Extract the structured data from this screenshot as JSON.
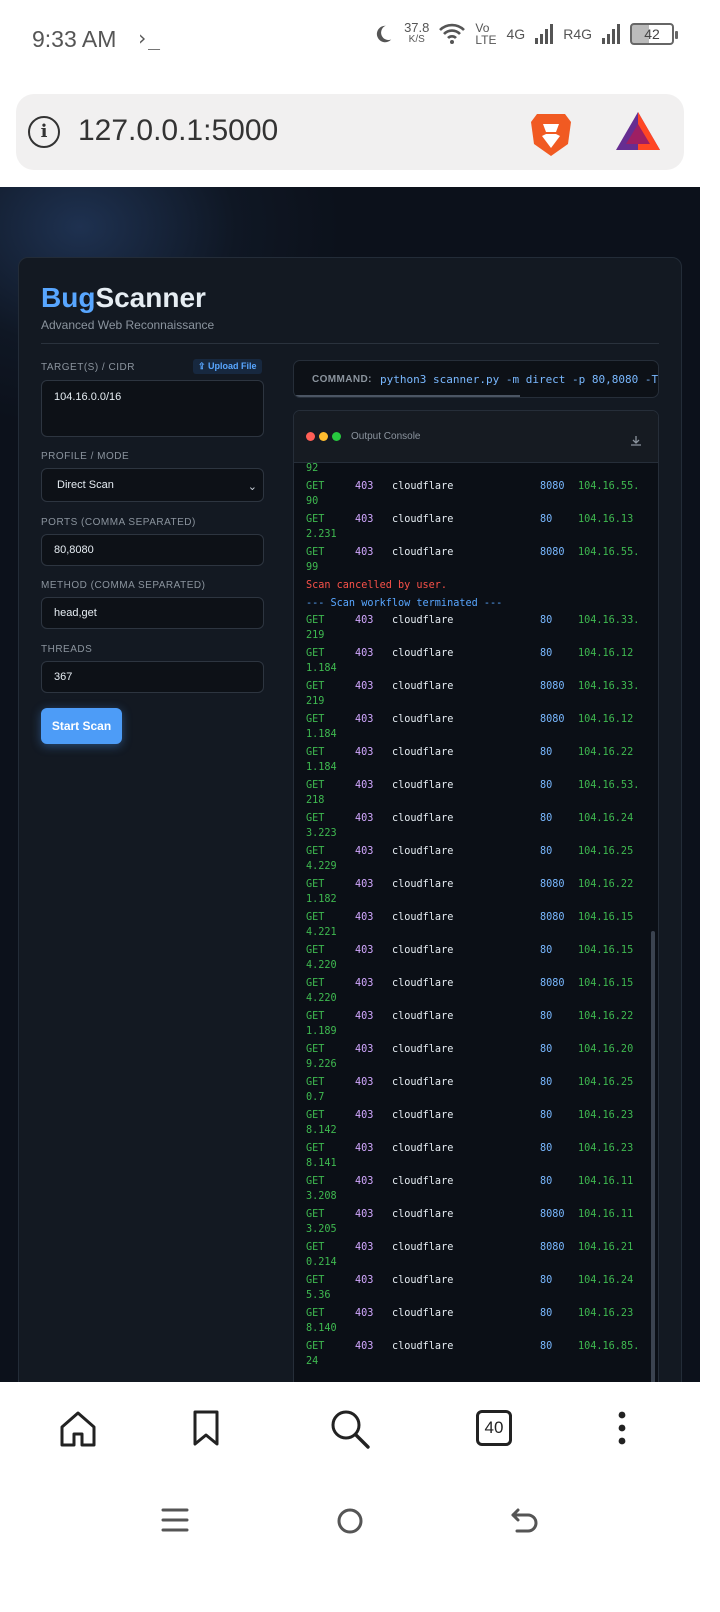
{
  "status_bar": {
    "time": "9:33 AM",
    "term_glyph": "›_",
    "speed_value": "37.8",
    "speed_unit": "K/S",
    "vo": "Vo",
    "lte": "LTE",
    "net1": "4G",
    "net2": "R4G",
    "battery": "42"
  },
  "browser": {
    "url": "127.0.0.1:5000",
    "tab_count": "40"
  },
  "app": {
    "brand_part1": "Bug",
    "brand_part2": "Scanner",
    "tagline": "Advanced Web Reconnaissance",
    "targets_label": "TARGET(S) / CIDR",
    "upload_label": "Upload File",
    "targets_value": "104.16.0.0/16",
    "profile_label": "PROFILE / MODE",
    "profile_value": "Direct Scan",
    "ports_label": "PORTS (COMMA SEPARATED)",
    "ports_value": "80,8080",
    "method_label": "METHOD (COMMA SEPARATED)",
    "method_value": "head,get",
    "threads_label": "THREADS",
    "threads_value": "367",
    "start_button": "Start Scan",
    "command_label": "COMMAND:",
    "command_text": "python3 scanner.py -m direct -p 80,8080 -T",
    "console_title": "Output Console",
    "colors": {
      "accent": "#58a6ff",
      "success": "#3fb950",
      "status": "#d2a8ff",
      "error": "#f85149"
    }
  },
  "console": {
    "top_fragment": "92",
    "rows_before": [
      {
        "method": "GET",
        "status": "403",
        "host": "cloudflare",
        "port": "8080",
        "ip": "104.16.55.",
        "ip2": "90"
      },
      {
        "method": "GET",
        "status": "403",
        "host": "cloudflare",
        "port": "80",
        "ip": "104.16.13",
        "ip2": "2.231"
      },
      {
        "method": "GET",
        "status": "403",
        "host": "cloudflare",
        "port": "8080",
        "ip": "104.16.55.",
        "ip2": "99"
      }
    ],
    "cancel_msg": "Scan cancelled by user.",
    "terminated_msg": "--- Scan workflow terminated ---",
    "rows_after": [
      {
        "method": "GET",
        "status": "403",
        "host": "cloudflare",
        "port": "80",
        "ip": "104.16.33.",
        "ip2": "219"
      },
      {
        "method": "GET",
        "status": "403",
        "host": "cloudflare",
        "port": "80",
        "ip": "104.16.12",
        "ip2": "1.184"
      },
      {
        "method": "GET",
        "status": "403",
        "host": "cloudflare",
        "port": "8080",
        "ip": "104.16.33.",
        "ip2": "219"
      },
      {
        "method": "GET",
        "status": "403",
        "host": "cloudflare",
        "port": "8080",
        "ip": "104.16.12",
        "ip2": "1.184"
      },
      {
        "method": "GET",
        "status": "403",
        "host": "cloudflare",
        "port": "80",
        "ip": "104.16.22",
        "ip2": "1.184"
      },
      {
        "method": "GET",
        "status": "403",
        "host": "cloudflare",
        "port": "80",
        "ip": "104.16.53.",
        "ip2": "218"
      },
      {
        "method": "GET",
        "status": "403",
        "host": "cloudflare",
        "port": "80",
        "ip": "104.16.24",
        "ip2": "3.223"
      },
      {
        "method": "GET",
        "status": "403",
        "host": "cloudflare",
        "port": "80",
        "ip": "104.16.25",
        "ip2": "4.229"
      },
      {
        "method": "GET",
        "status": "403",
        "host": "cloudflare",
        "port": "8080",
        "ip": "104.16.22",
        "ip2": "1.182"
      },
      {
        "method": "GET",
        "status": "403",
        "host": "cloudflare",
        "port": "8080",
        "ip": "104.16.15",
        "ip2": "4.221"
      },
      {
        "method": "GET",
        "status": "403",
        "host": "cloudflare",
        "port": "80",
        "ip": "104.16.15",
        "ip2": "4.220"
      },
      {
        "method": "GET",
        "status": "403",
        "host": "cloudflare",
        "port": "8080",
        "ip": "104.16.15",
        "ip2": "4.220"
      },
      {
        "method": "GET",
        "status": "403",
        "host": "cloudflare",
        "port": "80",
        "ip": "104.16.22",
        "ip2": "1.189"
      },
      {
        "method": "GET",
        "status": "403",
        "host": "cloudflare",
        "port": "80",
        "ip": "104.16.20",
        "ip2": "9.226"
      },
      {
        "method": "GET",
        "status": "403",
        "host": "cloudflare",
        "port": "80",
        "ip": "104.16.25",
        "ip2": "0.7"
      },
      {
        "method": "GET",
        "status": "403",
        "host": "cloudflare",
        "port": "80",
        "ip": "104.16.23",
        "ip2": "8.142"
      },
      {
        "method": "GET",
        "status": "403",
        "host": "cloudflare",
        "port": "80",
        "ip": "104.16.23",
        "ip2": "8.141"
      },
      {
        "method": "GET",
        "status": "403",
        "host": "cloudflare",
        "port": "80",
        "ip": "104.16.11",
        "ip2": "3.208"
      },
      {
        "method": "GET",
        "status": "403",
        "host": "cloudflare",
        "port": "8080",
        "ip": "104.16.11",
        "ip2": "3.205"
      },
      {
        "method": "GET",
        "status": "403",
        "host": "cloudflare",
        "port": "8080",
        "ip": "104.16.21",
        "ip2": "0.214"
      },
      {
        "method": "GET",
        "status": "403",
        "host": "cloudflare",
        "port": "80",
        "ip": "104.16.24",
        "ip2": "5.36"
      },
      {
        "method": "GET",
        "status": "403",
        "host": "cloudflare",
        "port": "80",
        "ip": "104.16.23",
        "ip2": "8.140"
      },
      {
        "method": "GET",
        "status": "403",
        "host": "cloudflare",
        "port": "80",
        "ip": "104.16.85.",
        "ip2": "24"
      }
    ]
  },
  "icons": {
    "home": "home-icon",
    "bookmark": "bookmark-icon",
    "search": "search-icon",
    "tabs": "tabs-icon",
    "menu": "more-vert-icon"
  }
}
